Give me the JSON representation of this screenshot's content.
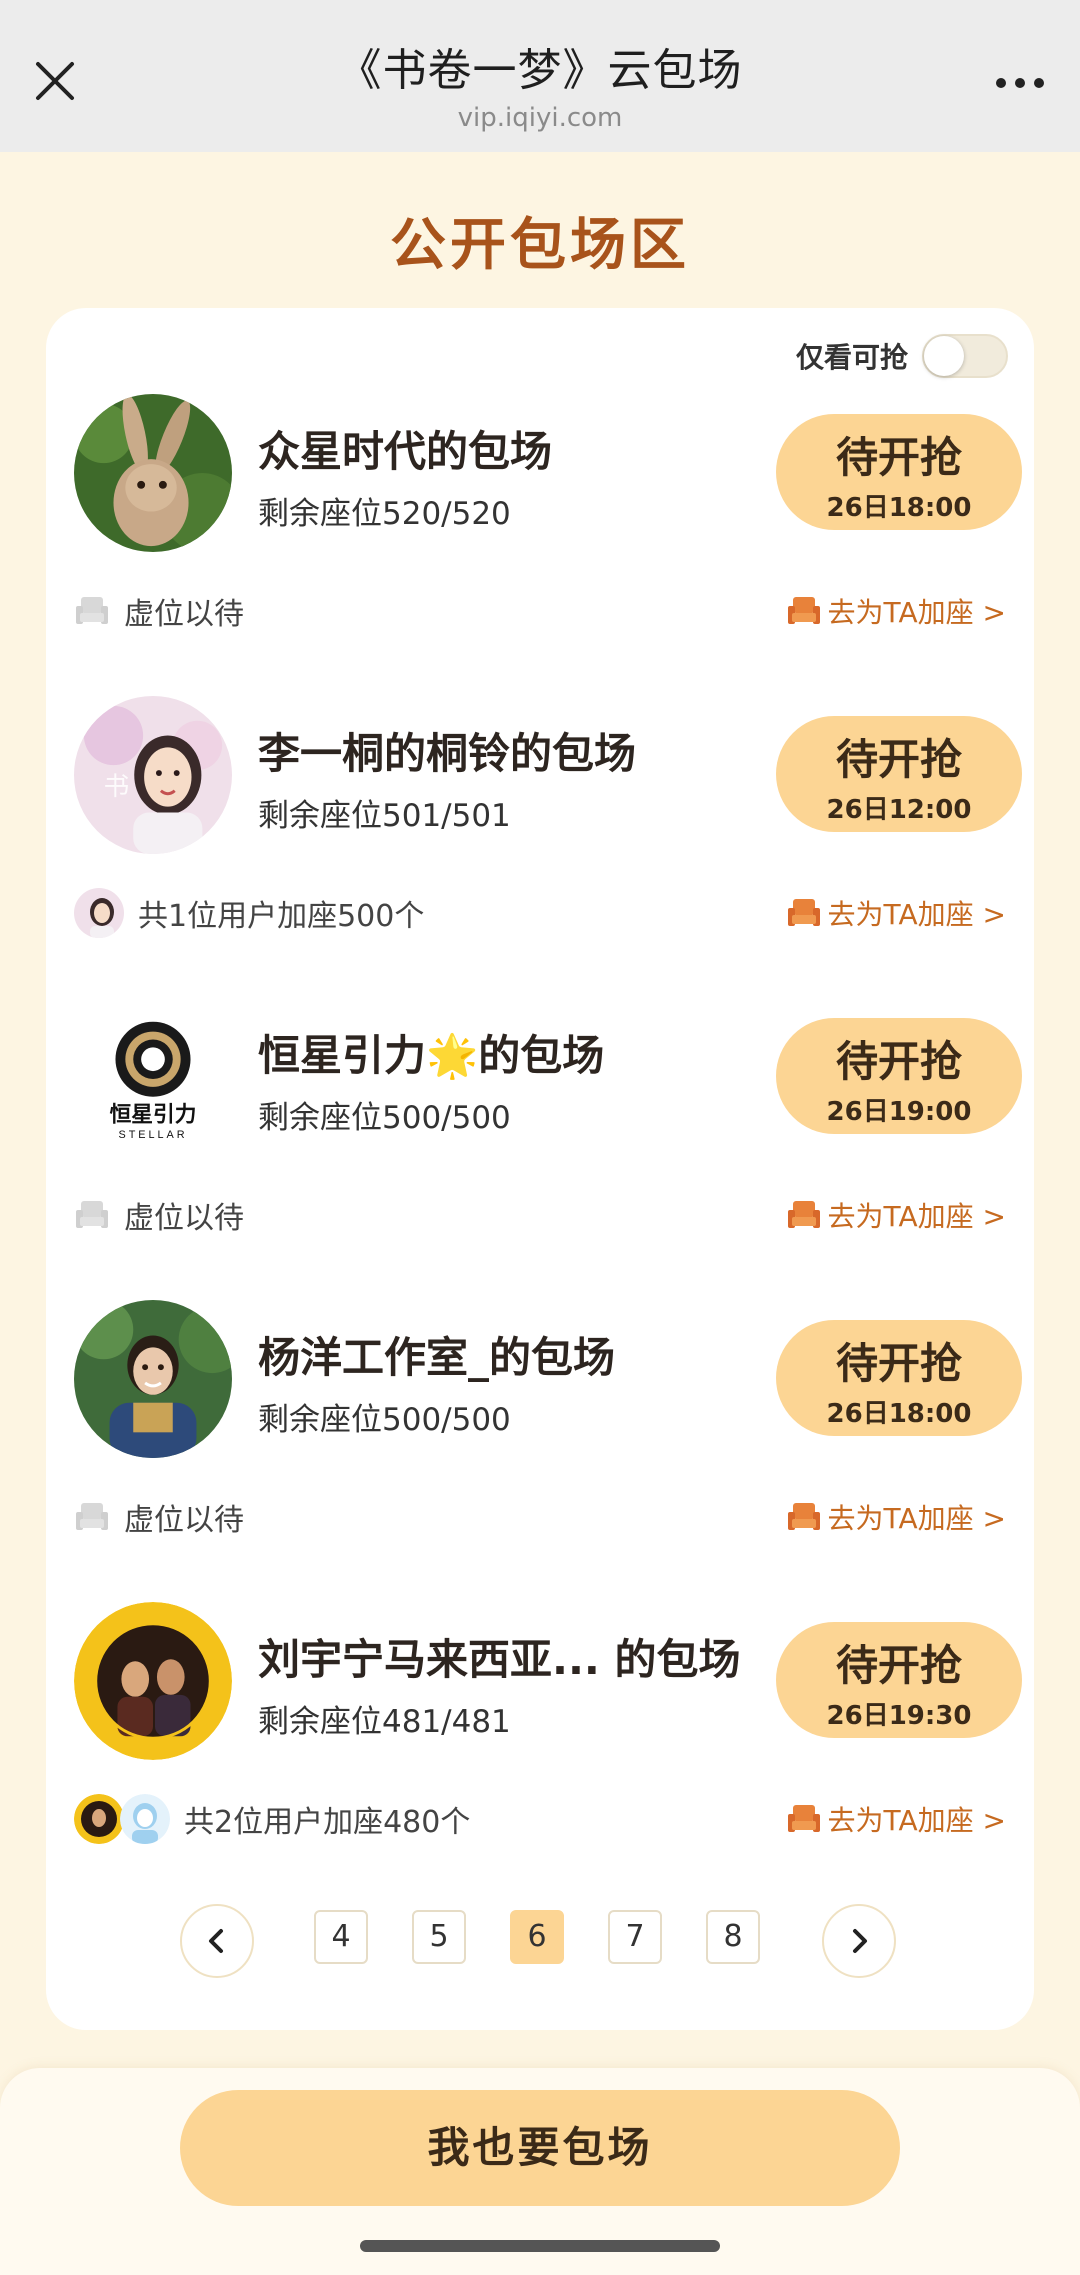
{
  "header": {
    "title": "《书卷一梦》云包场",
    "url": "vip.iqiyi.com"
  },
  "section": {
    "title": "公开包场区"
  },
  "filter": {
    "label": "仅看可抢",
    "enabled": false
  },
  "rows": [
    {
      "name": "众星时代的包场",
      "seats": "剩余座位520/520",
      "button_label": "待开抢",
      "button_time": "26日18:00",
      "sub_text": "虚位以待",
      "link_text": "去为TA加座 >"
    },
    {
      "name": "李一桐的桐铃的包场",
      "seats": "剩余座位501/501",
      "button_label": "待开抢",
      "button_time": "26日12:00",
      "sub_text": "共1位用户加座500个",
      "link_text": "去为TA加座 >"
    },
    {
      "name": "恒星引力🌟的包场",
      "seats": "剩余座位500/500",
      "button_label": "待开抢",
      "button_time": "26日19:00",
      "sub_text": "虚位以待",
      "link_text": "去为TA加座 >",
      "logo_text": "恒星引力",
      "logo_subtext": "STELLAR"
    },
    {
      "name": "杨洋工作室_的包场",
      "seats": "剩余座位500/500",
      "button_label": "待开抢",
      "button_time": "26日18:00",
      "sub_text": "虚位以待",
      "link_text": "去为TA加座 >"
    },
    {
      "name": "刘宇宁马来西亚... 的包场",
      "seats": "剩余座位481/481",
      "button_label": "待开抢",
      "button_time": "26日19:30",
      "sub_text": "共2位用户加座480个",
      "link_text": "去为TA加座 >"
    }
  ],
  "pagination": {
    "pages": [
      "4",
      "5",
      "6",
      "7",
      "8"
    ],
    "current": "6"
  },
  "cta": {
    "label": "我也要包场"
  },
  "colors": {
    "accent": "#fcd594",
    "title_brown": "#a8531b",
    "link_orange": "#c66a20",
    "background": "#fdf5e2"
  }
}
